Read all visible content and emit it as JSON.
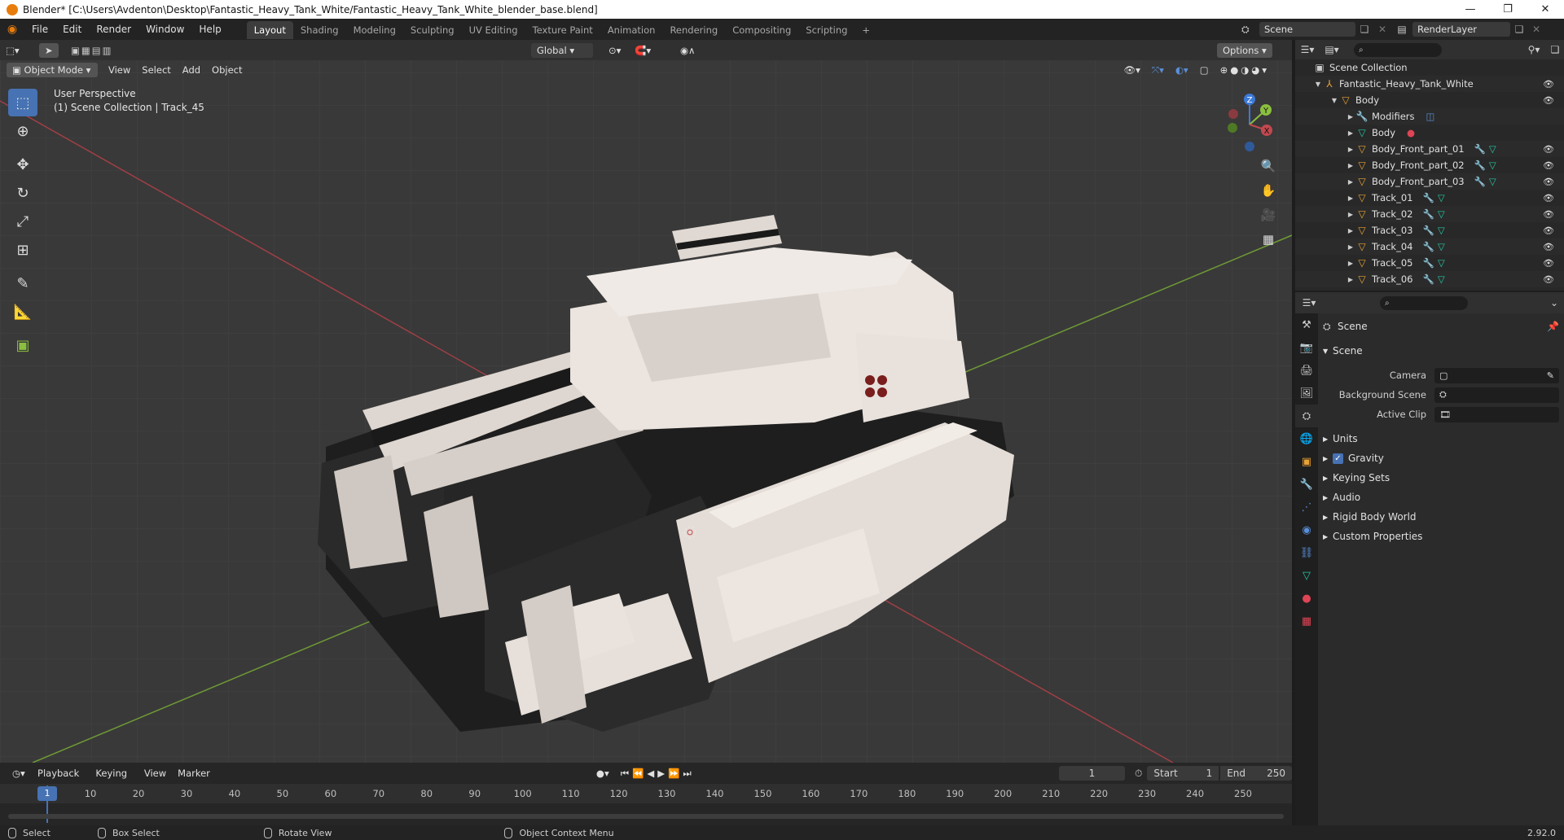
{
  "window": {
    "title": "Blender* [C:\\Users\\Avdenton\\Desktop\\Fantastic_Heavy_Tank_White/Fantastic_Heavy_Tank_White_blender_base.blend]",
    "controls": [
      "—",
      "❐",
      "✕"
    ]
  },
  "menu": [
    "File",
    "Edit",
    "Render",
    "Window",
    "Help"
  ],
  "workspaces": [
    "Layout",
    "Shading",
    "Modeling",
    "Sculpting",
    "UV Editing",
    "Texture Paint",
    "Animation",
    "Rendering",
    "Compositing",
    "Scripting"
  ],
  "active_workspace": "Layout",
  "add_workspace": "+",
  "scene_selector": {
    "value": "Scene"
  },
  "viewlayer_selector": {
    "value": "RenderLayer"
  },
  "viewport": {
    "mode": "Object Mode",
    "menus": [
      "View",
      "Select",
      "Add",
      "Object"
    ],
    "transform_orientation": "Global",
    "options_label": "Options",
    "overlay_title": "User Perspective",
    "overlay_subtitle": "(1) Scene Collection | Track_45",
    "gizmo": {
      "x": "X",
      "y": "Y",
      "z": "Z"
    }
  },
  "outliner": {
    "root": "Scene Collection",
    "rows": [
      {
        "label": "Fantastic_Heavy_Tank_White",
        "depth": 1,
        "icon": "collection"
      },
      {
        "label": "Body",
        "depth": 2,
        "icon": "object"
      },
      {
        "label": "Modifiers",
        "depth": 3,
        "icon": "wrench"
      },
      {
        "label": "Body",
        "depth": 3,
        "icon": "mesh"
      },
      {
        "label": "Body_Front_part_01",
        "depth": 3,
        "icon": "object"
      },
      {
        "label": "Body_Front_part_02",
        "depth": 3,
        "icon": "object"
      },
      {
        "label": "Body_Front_part_03",
        "depth": 3,
        "icon": "object"
      },
      {
        "label": "Track_01",
        "depth": 3,
        "icon": "object"
      },
      {
        "label": "Track_02",
        "depth": 3,
        "icon": "object"
      },
      {
        "label": "Track_03",
        "depth": 3,
        "icon": "object"
      },
      {
        "label": "Track_04",
        "depth": 3,
        "icon": "object"
      },
      {
        "label": "Track_05",
        "depth": 3,
        "icon": "object"
      },
      {
        "label": "Track_06",
        "depth": 3,
        "icon": "object"
      }
    ]
  },
  "properties": {
    "context_title": "Scene",
    "panel_title": "Scene",
    "fields": [
      {
        "label": "Camera"
      },
      {
        "label": "Background Scene"
      },
      {
        "label": "Active Clip"
      }
    ],
    "subpanels": [
      {
        "label": "Units",
        "checkbox": false
      },
      {
        "label": "Gravity",
        "checkbox": true
      },
      {
        "label": "Keying Sets",
        "checkbox": false
      },
      {
        "label": "Audio",
        "checkbox": false
      },
      {
        "label": "Rigid Body World",
        "checkbox": false
      },
      {
        "label": "Custom Properties",
        "checkbox": false
      }
    ]
  },
  "timeline": {
    "menus": [
      "Playback",
      "Keying",
      "View",
      "Marker"
    ],
    "current_frame": "1",
    "start_label": "Start",
    "start": "1",
    "end_label": "End",
    "end": "250",
    "ticks": [
      "1",
      "10",
      "20",
      "30",
      "40",
      "50",
      "60",
      "70",
      "80",
      "90",
      "100",
      "110",
      "120",
      "130",
      "140",
      "150",
      "160",
      "170",
      "180",
      "190",
      "200",
      "210",
      "220",
      "230",
      "240",
      "250"
    ]
  },
  "statusbar": {
    "items": [
      "Select",
      "Box Select",
      "Rotate View",
      "Object Context Menu"
    ],
    "version": "2.92.0"
  },
  "colors": {
    "accent": "#4772b3",
    "x_axis": "#c1494f",
    "y_axis": "#8bbf3f",
    "z_axis": "#3c7ad8",
    "orange": "#e8a235"
  }
}
